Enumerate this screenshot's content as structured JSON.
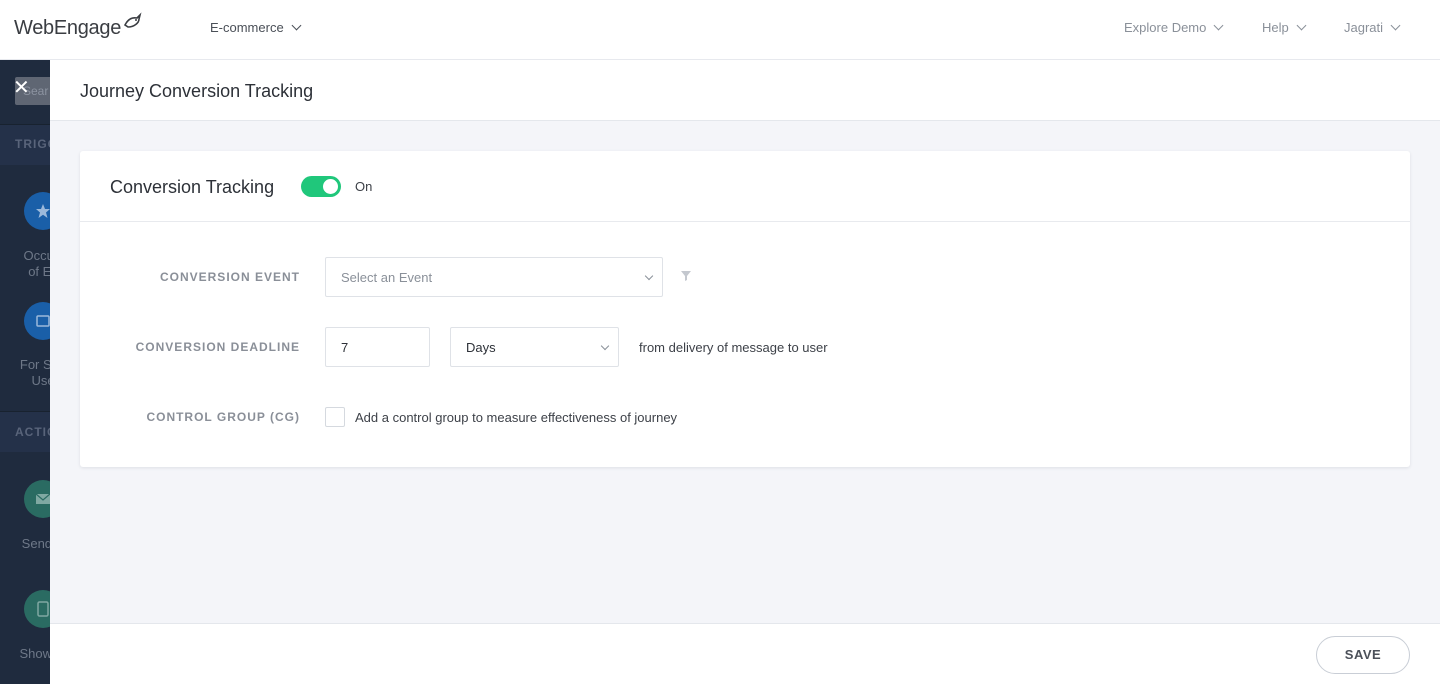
{
  "app": {
    "logo": "WebEngage",
    "project_selector": "E-commerce",
    "nav_right": [
      "Explore Demo",
      "Help",
      "Jagrati"
    ]
  },
  "sidebar": {
    "search_placeholder": "Sear",
    "sections": [
      "TRIGG",
      "ACTIO"
    ],
    "items": [
      {
        "icon": "star-icon",
        "label_line1": "Occurr",
        "label_line2": "of Ev",
        "color": "#1a5fa8"
      },
      {
        "icon": "csv-icon",
        "label_line1": "For Spe",
        "label_line2": "Use",
        "color": "#1a5fa8"
      },
      {
        "icon": "email-icon",
        "label_line1": "Send E",
        "label_line2": "",
        "color": "#2a6b62"
      },
      {
        "icon": "tablet-icon",
        "label_line1": "Show In",
        "label_line2": "",
        "color": "#2a6b62"
      }
    ]
  },
  "panel": {
    "title": "Journey Conversion Tracking",
    "card": {
      "title": "Conversion Tracking",
      "toggle_on": true,
      "toggle_label": "On",
      "toggle_color": "#20c77b",
      "conversion_event": {
        "label": "CONVERSION EVENT",
        "placeholder": "Select an Event"
      },
      "conversion_deadline": {
        "label": "CONVERSION DEADLINE",
        "value": "7",
        "unit": "Days",
        "suffix": "from delivery of message to user"
      },
      "control_group": {
        "label": "CONTROL GROUP (CG)",
        "checked": false,
        "text": "Add a control group to measure effectiveness of journey"
      }
    },
    "save_label": "SAVE"
  }
}
